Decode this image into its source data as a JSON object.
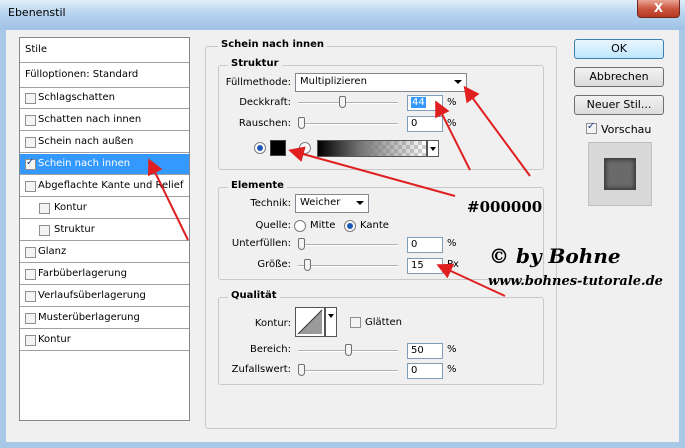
{
  "window": {
    "title": "Ebenenstil",
    "close_label": "X"
  },
  "style_list": {
    "items": [
      {
        "label": "Stile",
        "checkbox": false,
        "checked": false,
        "selected": false,
        "sub": false
      },
      {
        "label": "Fülloptionen: Standard",
        "checkbox": false,
        "checked": false,
        "selected": false,
        "sub": false
      },
      {
        "label": "Schlagschatten",
        "checkbox": true,
        "checked": false,
        "selected": false,
        "sub": false
      },
      {
        "label": "Schatten nach innen",
        "checkbox": true,
        "checked": false,
        "selected": false,
        "sub": false
      },
      {
        "label": "Schein nach außen",
        "checkbox": true,
        "checked": false,
        "selected": false,
        "sub": false
      },
      {
        "label": "Schein nach innen",
        "checkbox": true,
        "checked": true,
        "selected": true,
        "sub": false
      },
      {
        "label": "Abgeflachte Kante und Relief",
        "checkbox": true,
        "checked": false,
        "selected": false,
        "sub": false
      },
      {
        "label": "Kontur",
        "checkbox": true,
        "checked": false,
        "selected": false,
        "sub": true
      },
      {
        "label": "Struktur",
        "checkbox": true,
        "checked": false,
        "selected": false,
        "sub": true
      },
      {
        "label": "Glanz",
        "checkbox": true,
        "checked": false,
        "selected": false,
        "sub": false
      },
      {
        "label": "Farbüberlagerung",
        "checkbox": true,
        "checked": false,
        "selected": false,
        "sub": false
      },
      {
        "label": "Verlaufsüberlagerung",
        "checkbox": true,
        "checked": false,
        "selected": false,
        "sub": false
      },
      {
        "label": "Musterüberlagerung",
        "checkbox": true,
        "checked": false,
        "selected": false,
        "sub": false
      },
      {
        "label": "Kontur",
        "checkbox": true,
        "checked": false,
        "selected": false,
        "sub": false
      }
    ]
  },
  "panel": {
    "title": "Schein nach innen",
    "struktur": {
      "title": "Struktur",
      "fuellmethode_label": "Füllmethode:",
      "fuellmethode_value": "Multiplizieren",
      "deckkraft_label": "Deckkraft:",
      "deckkraft_value": "44",
      "deckkraft_unit": "%",
      "deckkraft_level": 0.44,
      "rauschen_label": "Rauschen:",
      "rauschen_value": "0",
      "rauschen_unit": "%",
      "rauschen_level": 0,
      "color": "#000000"
    },
    "elemente": {
      "title": "Elemente",
      "technik_label": "Technik:",
      "technik_value": "Weicher",
      "quelle_label": "Quelle:",
      "quelle_mitte": "Mitte",
      "quelle_kante": "Kante",
      "quelle_selected": "Kante",
      "unterfuellen_label": "Unterfüllen:",
      "unterfuellen_value": "0",
      "unterfuellen_unit": "%",
      "unterfuellen_level": 0,
      "groesse_label": "Größe:",
      "groesse_value": "15",
      "groesse_unit": "Px",
      "groesse_level": 0.06
    },
    "qualitaet": {
      "title": "Qualität",
      "kontur_label": "Kontur:",
      "glaetten_label": "Glätten",
      "glaetten_checked": false,
      "bereich_label": "Bereich:",
      "bereich_value": "50",
      "bereich_unit": "%",
      "bereich_level": 0.5,
      "zufall_label": "Zufallswert:",
      "zufall_value": "0",
      "zufall_unit": "%",
      "zufall_level": 0
    }
  },
  "buttons": {
    "ok": "OK",
    "cancel": "Abbrechen",
    "new_style": "Neuer Stil...",
    "preview_label": "Vorschau",
    "preview_checked": true
  },
  "annotations": {
    "color_code": "#000000",
    "copyright": "© by Bohne",
    "website": "www.bohnes-tutorale.de",
    "arrow_color": "#e02020"
  }
}
